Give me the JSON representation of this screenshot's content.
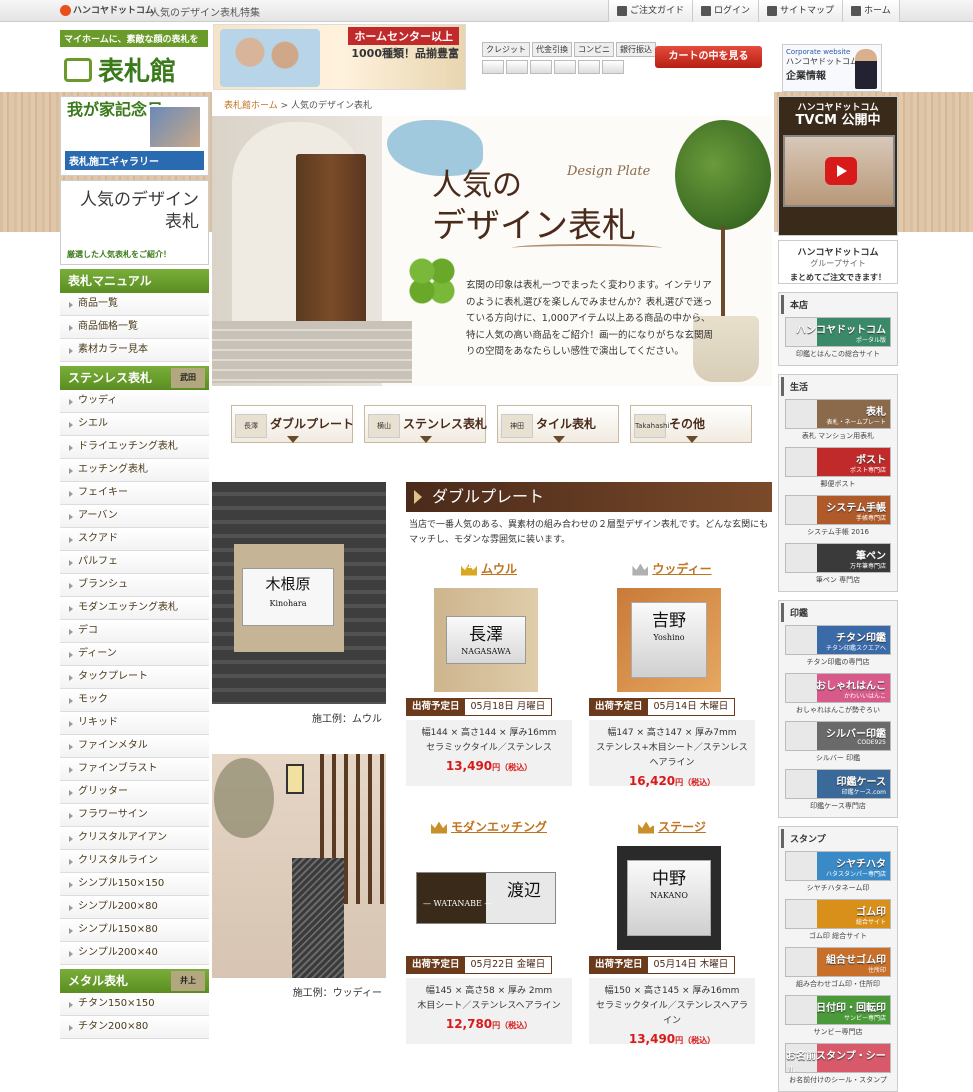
{
  "topbar": {
    "logo_text": "ハンコヤドットコム",
    "tagline": "人気のデザイン表札特集",
    "nav": [
      {
        "label": "ご注文ガイド",
        "icon": "guide-icon"
      },
      {
        "label": "ログイン",
        "icon": "lock-icon"
      },
      {
        "label": "サイトマップ",
        "icon": "document-icon"
      },
      {
        "label": "ホーム",
        "icon": "home-icon"
      }
    ]
  },
  "header": {
    "slogan": "マイホームに、素敵な顔の表札を",
    "brand": "表札館",
    "banner_line1": "ホームセンター以上",
    "banner_line2": "1000種類！品揃豊富",
    "pay_labels": [
      "クレジット",
      "代金引換",
      "コンビニ",
      "銀行振込"
    ],
    "cart_button": "カートの中を見る",
    "corp_line1": "Corporate website",
    "corp_line2": "ハンコヤドットコム",
    "corp_line3": "企業情報"
  },
  "left": {
    "banner1_title": "我が家記念日",
    "banner1_bar": "表札施工ギャラリー",
    "banner2_title": "人気のデザイン表札",
    "banner2_sub": "厳選した人気表札をご紹介！",
    "sections": [
      {
        "title": "表札マニュアル",
        "tag": "",
        "items": [
          "商品一覧",
          "商品価格一覧",
          "素材カラー見本"
        ]
      },
      {
        "title": "ステンレス表札",
        "tag": "武田",
        "items": [
          "ウッディ",
          "シエル",
          "ドライエッチング表札",
          "エッチング表札",
          "フェイキー",
          "アーバン",
          "スクアド",
          "パルフェ",
          "ブランシュ",
          "モダンエッチング表札",
          "デコ",
          "ディーン",
          "タックプレート",
          "モック",
          "リキッド",
          "ファインメタル",
          "ファインブラスト",
          "グリッター",
          "フラワーサイン",
          "クリスタルアイアン",
          "クリスタルライン",
          "シンプル150×150",
          "シンプル200×80",
          "シンプル150×80",
          "シンプル200×40"
        ]
      },
      {
        "title": "メタル表札",
        "tag": "井上",
        "items": [
          "チタン150×150",
          "チタン200×80"
        ]
      }
    ]
  },
  "breadcrumb": {
    "home": "表札館ホーム",
    "sep": ">",
    "current": "人気のデザイン表札"
  },
  "hero": {
    "title1": "人気の",
    "title_en": "Design Plate",
    "title2": "デザイン表札",
    "desc": "玄関の印象は表札一つでまったく変わります。インテリアのように表札選びを楽しんでみませんか？表札選びで迷っている方向けに、1,000アイテム以上ある商品の中から、特に人気の高い商品をご紹介！画一的になりがちな玄関周りの空間をあなたらしい感性で演出してください。"
  },
  "tabs": [
    {
      "label": "ダブルプレート",
      "thumb": "長澤"
    },
    {
      "label": "ステンレス表札",
      "thumb": "横山"
    },
    {
      "label": "タイル表札",
      "thumb": "神田"
    },
    {
      "label": "その他",
      "thumb": "Takahashi"
    }
  ],
  "examples": [
    {
      "caption": "施工例：ムウル",
      "plate_main": "木根原",
      "plate_sub": "Kinohara"
    },
    {
      "caption": "施工例：ウッディー"
    }
  ],
  "section": {
    "title": "ダブルプレート",
    "desc": "当店で一番人気のある、異素材の組み合わせの２層型デザイン表札です。どんな玄関にもマッチし、モダンな雰囲気に装います。"
  },
  "products": [
    {
      "rank": "1",
      "name": "ムウル",
      "crown_color": "#d8a820",
      "plate_main": "長澤",
      "plate_sub": "NAGASAWA",
      "ship_label": "出荷予定日",
      "ship_date": "05月18日 月曜日",
      "size": "幅144 × 高さ144 × 厚み16mm",
      "material": "セラミックタイル／ステンレス",
      "price": "13,490",
      "yen": "円",
      "tax": "（税込）"
    },
    {
      "rank": "2",
      "name": "ウッディー",
      "crown_color": "#b0b0b0",
      "plate_main": "吉野",
      "plate_sub": "Yoshino",
      "ship_label": "出荷予定日",
      "ship_date": "05月14日 木曜日",
      "size": "幅147 × 高さ147 × 厚み7mm",
      "material": "ステンレス+木目シート／ステンレスヘアライン",
      "price": "16,420",
      "yen": "円",
      "tax": "（税込）"
    },
    {
      "rank": "3",
      "name": "モダンエッチング",
      "crown_color": "#c8902a",
      "plate_main": "渡辺",
      "plate_sub": "— WATANABE —",
      "ship_label": "出荷予定日",
      "ship_date": "05月22日 金曜日",
      "size": "幅145 × 高さ58 × 厚み 2mm",
      "material": "木目シート／ステンレスヘアライン",
      "price": "12,780",
      "yen": "円",
      "tax": "（税込）"
    },
    {
      "rank": "4",
      "name": "ステージ",
      "crown_color": "#c8902a",
      "plate_main": "中野",
      "plate_sub": "NAKANO",
      "ship_label": "出荷予定日",
      "ship_date": "05月14日 木曜日",
      "size": "幅150 × 高さ145 × 厚み16mm",
      "material": "セラミックタイル／ステンレスヘアライン",
      "price": "13,490",
      "yen": "円",
      "tax": "（税込）"
    }
  ],
  "right": {
    "tvcm_brand": "ハンコヤドットコム",
    "tvcm_title": "TVCM 公開中",
    "group_title": "ハンコヤドットコム",
    "group_sub": "グループサイト",
    "group_note": "まとめてご注文できます！",
    "sections": [
      {
        "title": "本店",
        "items": [
          {
            "banner": "ハンコヤドットコム",
            "small": "ポータル版",
            "caption": "印鑑とはんこの総合サイト",
            "color": "#3a8a6a"
          }
        ]
      },
      {
        "title": "生活",
        "items": [
          {
            "banner": "表札",
            "small": "表札・ネームプレート",
            "caption": "表札 マンション用表札",
            "color": "#8a6a4a"
          },
          {
            "banner": "ポスト",
            "small": "ポスト専門店",
            "caption": "郵便ポスト",
            "color": "#c02a2a"
          },
          {
            "banner": "システム手帳",
            "small": "手帳専門店",
            "caption": "システム手帳 2016",
            "color": "#b05a2a"
          },
          {
            "banner": "筆ペン",
            "small": "万年筆専門店",
            "caption": "筆ペン 専門店",
            "color": "#3a3a3a"
          }
        ]
      },
      {
        "title": "印鑑",
        "items": [
          {
            "banner": "チタン印鑑",
            "small": "チタン印鑑スクエアへ",
            "caption": "チタン印鑑の専門店",
            "color": "#3a6aa8"
          },
          {
            "banner": "おしゃれはんこ",
            "small": "かわいいはんこ",
            "caption": "おしゃれはんこが勢ぞろい",
            "color": "#d85a8a"
          },
          {
            "banner": "シルバー印鑑",
            "small": "CODE925",
            "caption": "シルバー 印鑑",
            "color": "#6a6a6a"
          },
          {
            "banner": "印鑑ケース",
            "small": "印鑑ケース.com",
            "caption": "印鑑ケース専門店",
            "color": "#3a6a9a"
          }
        ]
      },
      {
        "title": "スタンプ",
        "items": [
          {
            "banner": "シヤチハタ",
            "small": "ハタスタンパー専門店",
            "caption": "シヤチハタネーム印",
            "color": "#3a8ac8"
          },
          {
            "banner": "ゴム印",
            "small": "総合サイト",
            "caption": "ゴム印 総合サイト",
            "color": "#d8901a"
          },
          {
            "banner": "組合せゴム印",
            "small": "住所印",
            "caption": "組み合わせゴム印・住所印",
            "color": "#c8702a"
          },
          {
            "banner": "日付印・回転印",
            "small": "サンビー専門店",
            "caption": "サンビー専門店",
            "color": "#4a9a3a"
          },
          {
            "banner": "お名前スタンプ・シール",
            "small": "",
            "caption": "お名前付けのシール・スタンプ",
            "color": "#d85a6a"
          }
        ]
      }
    ]
  }
}
